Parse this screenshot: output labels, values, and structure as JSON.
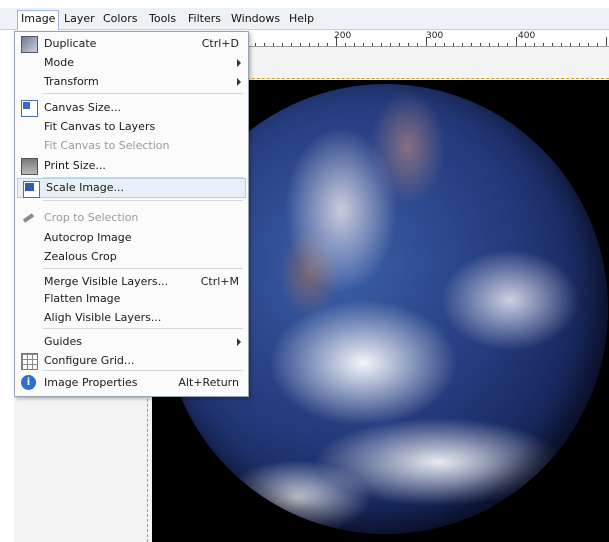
{
  "menubar": {
    "items": [
      "Image",
      "Layer",
      "Colors",
      "Tools",
      "Filters",
      "Windows",
      "Help"
    ]
  },
  "ruler": {
    "labels": [
      "200",
      "300",
      "400"
    ]
  },
  "image_menu": {
    "items": [
      {
        "label": "Duplicate",
        "accel": "Ctrl+D",
        "icon": "duplicate-icon"
      },
      {
        "label": "Mode",
        "submenu": true
      },
      {
        "label": "Transform",
        "submenu": true
      },
      {
        "label": "Canvas Size...",
        "icon": "canvas-size-icon"
      },
      {
        "label": "Fit Canvas to Layers"
      },
      {
        "label": "Fit Canvas to Selection",
        "disabled": true
      },
      {
        "label": "Print Size...",
        "icon": "print-size-icon"
      },
      {
        "label": "Scale Image...",
        "icon": "scale-image-icon",
        "highlighted": true
      },
      {
        "label": "Crop to Selection",
        "icon": "crop-icon",
        "disabled": true
      },
      {
        "label": "Autocrop Image"
      },
      {
        "label": "Zealous Crop"
      },
      {
        "label": "Merge Visible Layers...",
        "accel": "Ctrl+M"
      },
      {
        "label": "Flatten Image"
      },
      {
        "label": "Aligh Visible Layers..."
      },
      {
        "label": "Guides",
        "submenu": true
      },
      {
        "label": "Configure Grid...",
        "icon": "grid-icon"
      },
      {
        "label": "Image Properties",
        "accel": "Alt+Return",
        "icon": "info-icon"
      }
    ]
  },
  "colors": {
    "menu_highlight": "#e7eff9",
    "disabled_text": "#9a9a9a",
    "selection_dash": "#c8a020"
  }
}
